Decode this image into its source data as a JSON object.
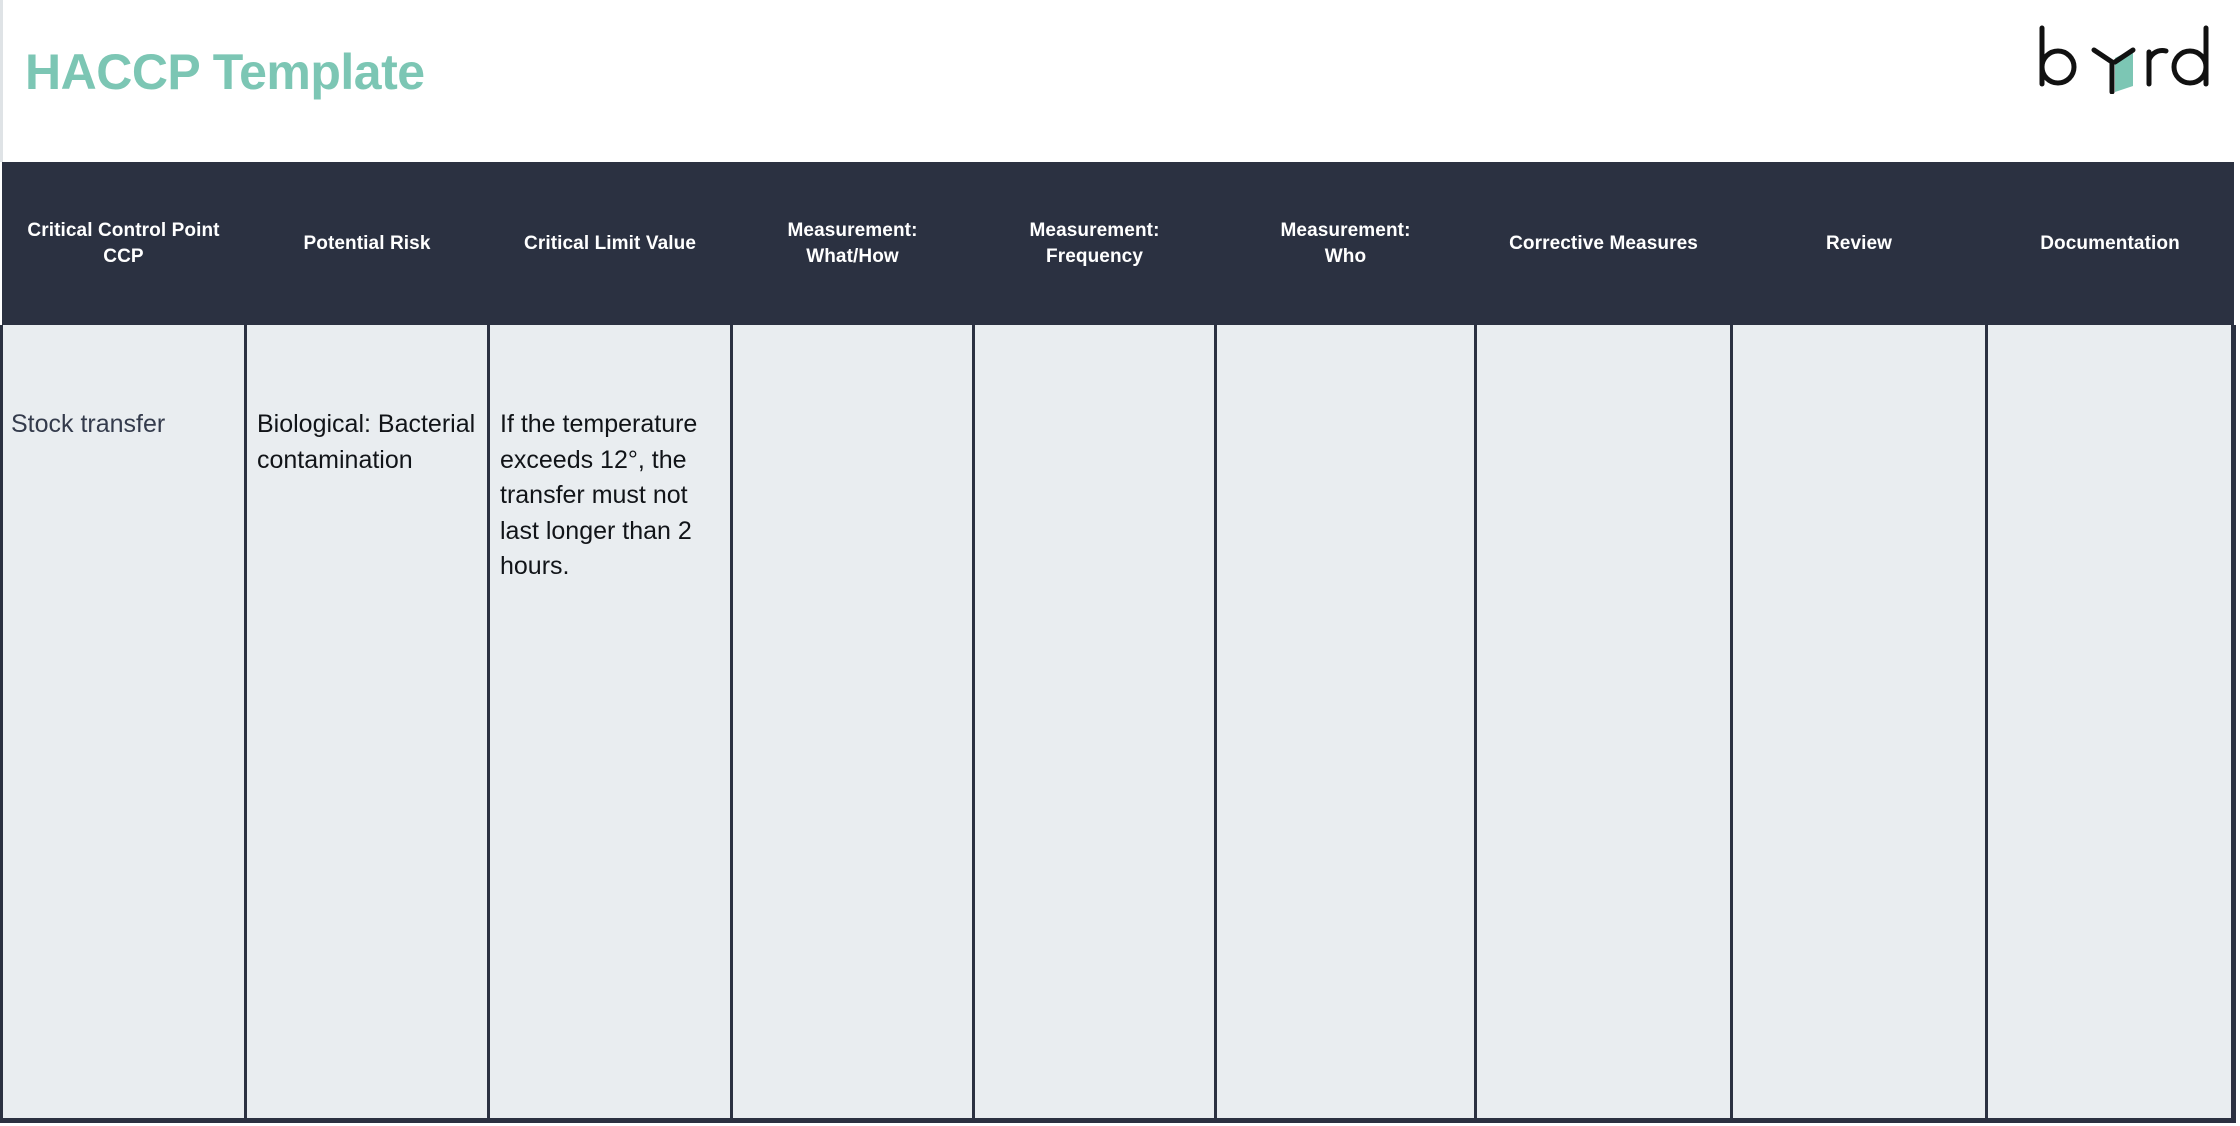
{
  "document": {
    "title": "HACCP Template",
    "title_color": "#7cc6b4",
    "brand": {
      "name": "byrd",
      "accent_color": "#7cc6b4",
      "text_color": "#111111"
    }
  },
  "theme": {
    "header_bg": "#2b3141",
    "header_text": "#ffffff",
    "cell_bg": "#e9edf0",
    "cell_text": "#111418",
    "border": "#2b3141",
    "page_bg": "#ffffff"
  },
  "table": {
    "columns": [
      {
        "id": "ccp",
        "label": "Critical Control Point\nCCP"
      },
      {
        "id": "potential_risk",
        "label": "Potential Risk"
      },
      {
        "id": "critical_limit_value",
        "label": "Critical Limit Value"
      },
      {
        "id": "measurement_what_how",
        "label": "Measurement:\nWhat/How"
      },
      {
        "id": "measurement_frequency",
        "label": "Measurement:\nFrequency"
      },
      {
        "id": "measurement_who",
        "label": "Measurement:\nWho"
      },
      {
        "id": "corrective_measures",
        "label": "Corrective Measures"
      },
      {
        "id": "review",
        "label": "Review"
      },
      {
        "id": "documentation",
        "label": "Documentation"
      }
    ],
    "rows": [
      {
        "ccp": "Stock transfer",
        "potential_risk": "Biological: Bacterial contamination",
        "critical_limit_value": "If the temperature exceeds 12°, the transfer must not last longer than 2 hours.",
        "measurement_what_how": "",
        "measurement_frequency": "",
        "measurement_who": "",
        "corrective_measures": "",
        "review": "",
        "documentation": ""
      }
    ]
  }
}
